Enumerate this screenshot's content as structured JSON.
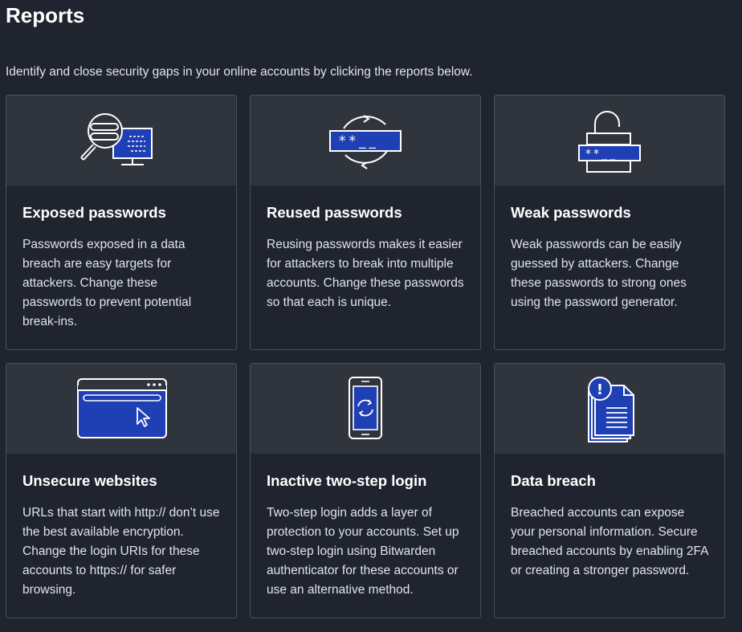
{
  "page": {
    "title": "Reports",
    "subtitle": "Identify and close security gaps in your online accounts by clicking the reports below."
  },
  "colors": {
    "background": "#1f242e",
    "hero": "#2f343d",
    "accent_blue": "#1f3fb5",
    "border": "#4a505c"
  },
  "reports": [
    {
      "icon": "magnifier-monitor-icon",
      "title": "Exposed passwords",
      "description": "Passwords exposed in a data breach are easy targets for attackers. Change these passwords to prevent potential break-ins.",
      "masked_text": ""
    },
    {
      "icon": "reused-password-cycle-icon",
      "title": "Reused passwords",
      "description": "Reusing passwords makes it easier for attackers to break into multiple accounts. Change these passwords so that each is unique.",
      "masked_text": "**__"
    },
    {
      "icon": "padlock-open-icon",
      "title": "Weak passwords",
      "description": "Weak passwords can be easily guessed by attackers. Change these passwords to strong ones using the password generator.",
      "masked_text": "**__"
    },
    {
      "icon": "browser-window-icon",
      "title": "Unsecure websites",
      "description": "URLs that start with http:// don’t use the best available encryption. Change the login URIs for these accounts to https:// for safer browsing.",
      "masked_text": ""
    },
    {
      "icon": "phone-sync-icon",
      "title": "Inactive two-step login",
      "description": "Two-step login adds a layer of protection to your accounts. Set up two-step login using Bitwarden authenticator for these accounts or use an alternative method.",
      "masked_text": ""
    },
    {
      "icon": "document-alert-icon",
      "title": "Data breach",
      "description": "Breached accounts can expose your personal information. Secure breached accounts by enabling 2FA or creating a stronger password.",
      "masked_text": "!"
    }
  ]
}
